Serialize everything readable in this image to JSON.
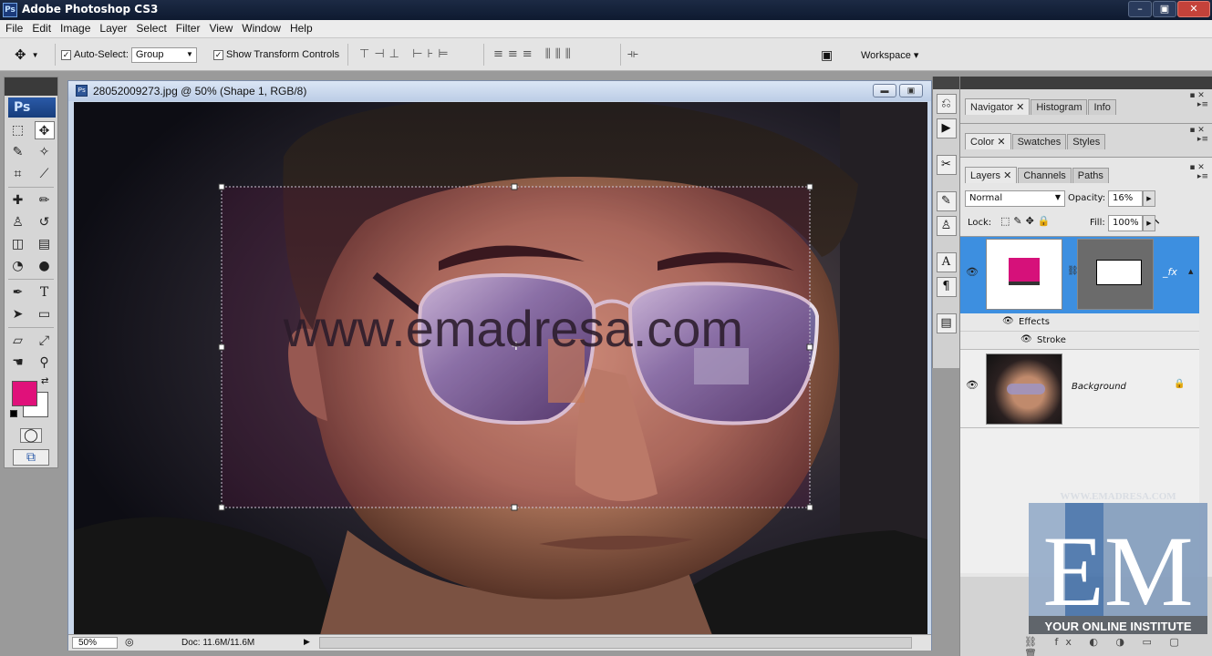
{
  "app": {
    "title": "Adobe Photoshop CS3",
    "icon": "Ps"
  },
  "window_controls": [
    "–",
    "▣",
    "✕"
  ],
  "menu": [
    "File",
    "Edit",
    "Image",
    "Layer",
    "Select",
    "Filter",
    "View",
    "Window",
    "Help"
  ],
  "options": {
    "auto_select_label": "Auto-Select:",
    "auto_select_checked": true,
    "auto_select_value": "Group",
    "show_transform_label": "Show Transform Controls",
    "show_transform_checked": true,
    "workspace_label": "Workspace ▾"
  },
  "tools": {
    "logo": "Ps"
  },
  "document": {
    "title": "28052009273.jpg @ 50% (Shape 1, RGB/8)",
    "overlay_text": "www.emadresa.com",
    "zoom": "50%",
    "doc_size": "Doc: 11.6M/11.6M"
  },
  "panels": {
    "group1_tabs": [
      "Navigator",
      "Histogram",
      "Info"
    ],
    "group2_tabs": [
      "Color",
      "Swatches",
      "Styles"
    ],
    "layers_tabs": [
      "Layers",
      "Channels",
      "Paths"
    ]
  },
  "layers": {
    "blend_mode": "Normal",
    "opacity_label": "Opacity:",
    "opacity_value": "16%",
    "lock_label": "Lock:",
    "fill_label": "Fill:",
    "fill_value": "100%",
    "effects_label": "Effects",
    "stroke_label": "Stroke",
    "background_label": "Background"
  },
  "colors": {
    "foreground": "#e0117a",
    "background": "#ffffff",
    "shape_fill": "#d6117a",
    "selected_layer": "#3d8fe0"
  },
  "watermark": {
    "top_text": "WWW.EMADRESA.COM",
    "letters": "EM",
    "bottom_text": "YOUR ONLINE INSTITUTE"
  }
}
